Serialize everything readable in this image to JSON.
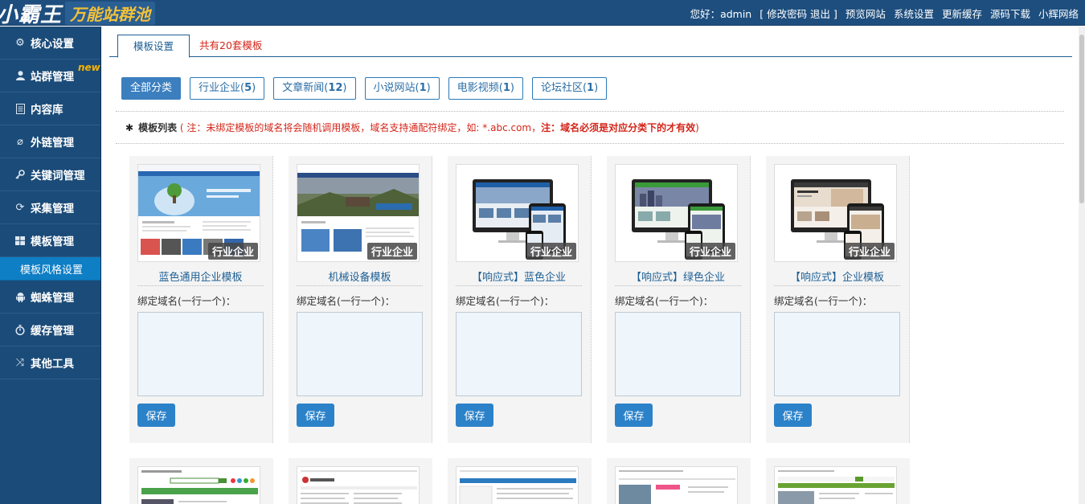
{
  "header": {
    "logo_main": "小霸王",
    "logo_sub": "万能站群池",
    "greeting": "您好：admin",
    "account_links": "[ 修改密码 退出 ]",
    "nav": [
      "预览网站",
      "系统设置",
      "更新缓存",
      "源码下载",
      "小辉网络"
    ]
  },
  "sidebar": {
    "items": [
      {
        "label": "核心设置",
        "icon": "gear-icon"
      },
      {
        "label": "站群管理",
        "icon": "user-icon",
        "badge": "new"
      },
      {
        "label": "内容库",
        "icon": "document-icon"
      },
      {
        "label": "外链管理",
        "icon": "link-icon"
      },
      {
        "label": "关键词管理",
        "icon": "key-icon"
      },
      {
        "label": "采集管理",
        "icon": "refresh-icon"
      },
      {
        "label": "模板管理",
        "icon": "windows-icon"
      },
      {
        "label": "模板风格设置",
        "sub": true
      },
      {
        "label": "蜘蛛管理",
        "icon": "android-icon"
      },
      {
        "label": "缓存管理",
        "icon": "stopwatch-icon"
      },
      {
        "label": "其他工具",
        "icon": "shuffle-icon"
      }
    ]
  },
  "tabs": {
    "active": "模板设置",
    "count_text": "共有20套模板"
  },
  "filters": [
    {
      "label": "全部分类",
      "count": "",
      "active": true
    },
    {
      "label": "行业企业",
      "count": "5"
    },
    {
      "label": "文章新闻",
      "count": "12"
    },
    {
      "label": "小说网站",
      "count": "1"
    },
    {
      "label": "电影视频",
      "count": "1"
    },
    {
      "label": "论坛社区",
      "count": "1"
    }
  ],
  "list_header": {
    "title": "模板列表",
    "open": "(",
    "note": "注：未绑定模板的域名将会随机调用模板，域名支持通配符绑定，如: *.abc.com，",
    "note_bold": "注：域名必须是对应分类下的才有效",
    "close": ")"
  },
  "cards": [
    {
      "title": "蓝色通用企业模板",
      "category": "行业企业",
      "bind_label": "绑定域名(一行一个)：",
      "save": "保存"
    },
    {
      "title": "机械设备模板",
      "category": "行业企业",
      "bind_label": "绑定域名(一行一个)：",
      "save": "保存"
    },
    {
      "title": "【响应式】蓝色企业",
      "category": "行业企业",
      "bind_label": "绑定域名(一行一个)：",
      "save": "保存"
    },
    {
      "title": "【响应式】绿色企业",
      "category": "行业企业",
      "bind_label": "绑定域名(一行一个)：",
      "save": "保存"
    },
    {
      "title": "【响应式】企业模板",
      "category": "行业企业",
      "bind_label": "绑定域名(一行一个)：",
      "save": "保存"
    }
  ]
}
